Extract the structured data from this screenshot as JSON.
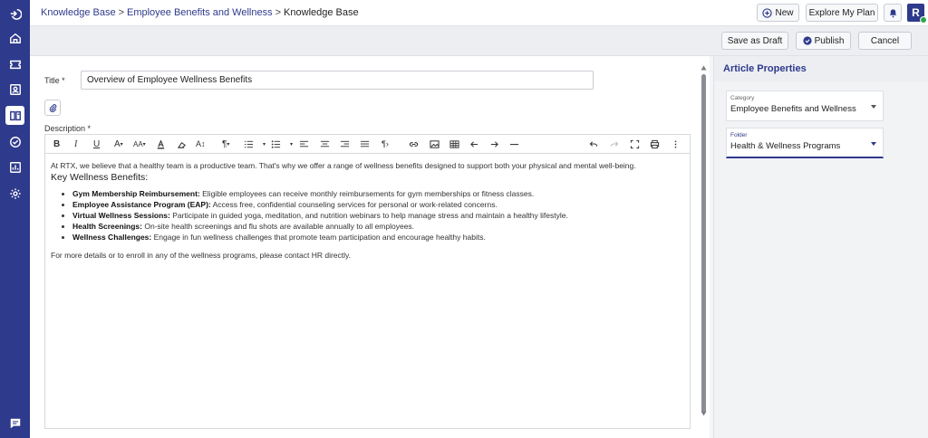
{
  "breadcrumb": {
    "items": [
      "Knowledge Base",
      "Employee Benefits and Wellness"
    ],
    "separator": ">",
    "current": "Knowledge Base"
  },
  "header": {
    "new_label": "New",
    "explore_label": "Explore My Plan",
    "avatar_initial": "R"
  },
  "actions": {
    "save_draft": "Save as Draft",
    "publish": "Publish",
    "cancel": "Cancel"
  },
  "form": {
    "title_label": "Title *",
    "title_value": "Overview of Employee Wellness Benefits",
    "description_label": "Description *"
  },
  "toolbar": {
    "bold": "B",
    "italic": "I",
    "underline": "U",
    "font_color": "A",
    "font_size": "AA",
    "line_height": "A↕",
    "paragraph": "¶"
  },
  "article": {
    "intro": "At RTX, we believe that a healthy team is a productive team. That's why we offer a range of wellness benefits designed to support both your physical and mental well-being.",
    "heading": "Key Wellness Benefits:",
    "benefits": [
      {
        "name": "Gym Membership Reimbursement:",
        "text": " Eligible employees can receive monthly reimbursements for gym memberships or fitness classes."
      },
      {
        "name": "Employee Assistance Program (EAP):",
        "text": " Access free, confidential counseling services for personal or work-related concerns."
      },
      {
        "name": "Virtual Wellness Sessions:",
        "text": " Participate in guided yoga, meditation, and nutrition webinars to help manage stress and maintain a healthy lifestyle."
      },
      {
        "name": "Health Screenings:",
        "text": " On-site health screenings and flu shots are available annually to all employees."
      },
      {
        "name": "Wellness Challenges:",
        "text": " Engage in fun wellness challenges that promote team participation and encourage healthy habits."
      }
    ],
    "footer": "For more details or to enroll in any of the wellness programs, please contact HR directly."
  },
  "properties": {
    "heading": "Article Properties",
    "category_label": "Category",
    "category_value": "Employee Benefits and Wellness",
    "folder_label": "Folder",
    "folder_value": "Health & Wellness Programs"
  },
  "colors": {
    "brand": "#2e3a8c",
    "status_online": "#2ea44f"
  }
}
